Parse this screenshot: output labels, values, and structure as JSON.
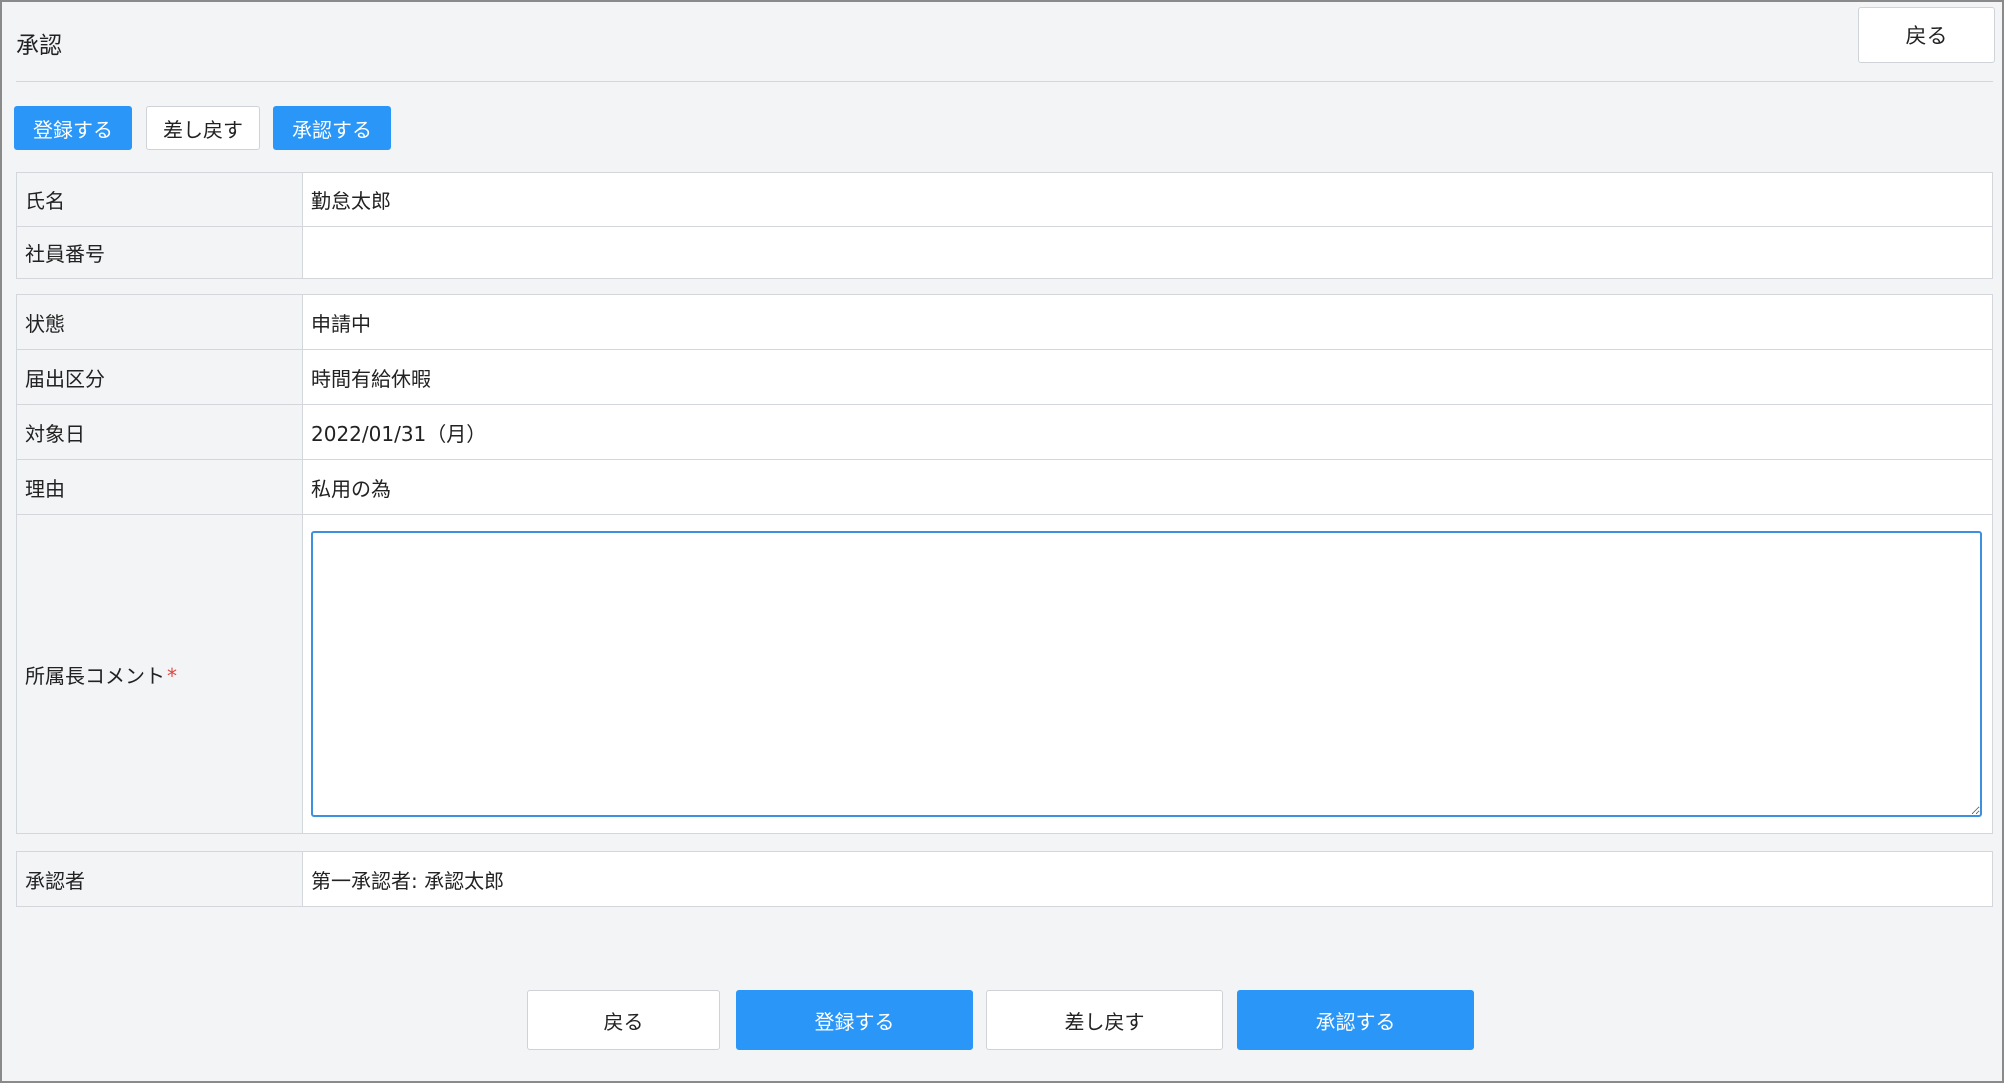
{
  "header": {
    "title": "承認",
    "back_label": "戻る"
  },
  "top_actions": {
    "register": "登録する",
    "return": "差し戻す",
    "approve": "承認する"
  },
  "employee": {
    "name_label": "氏名",
    "name_value": "勤怠太郎",
    "number_label": "社員番号",
    "number_value": ""
  },
  "request": {
    "status_label": "状態",
    "status_value": "申請中",
    "type_label": "届出区分",
    "type_value": "時間有給休暇",
    "date_label": "対象日",
    "date_value": "2022/01/31（月）",
    "reason_label": "理由",
    "reason_value": "私用の為",
    "comment_label": "所属長コメント",
    "comment_required_mark": "*",
    "comment_value": "",
    "comment_placeholder": ""
  },
  "approver": {
    "label": "承認者",
    "value": "第一承認者: 承認太郎"
  },
  "bottom_actions": {
    "back": "戻る",
    "register": "登録する",
    "return": "差し戻す",
    "approve": "承認する"
  },
  "colors": {
    "primary": "#2a96f8",
    "background": "#f3f4f6",
    "required": "#e0443e",
    "focus_border": "#3d8fe0"
  }
}
